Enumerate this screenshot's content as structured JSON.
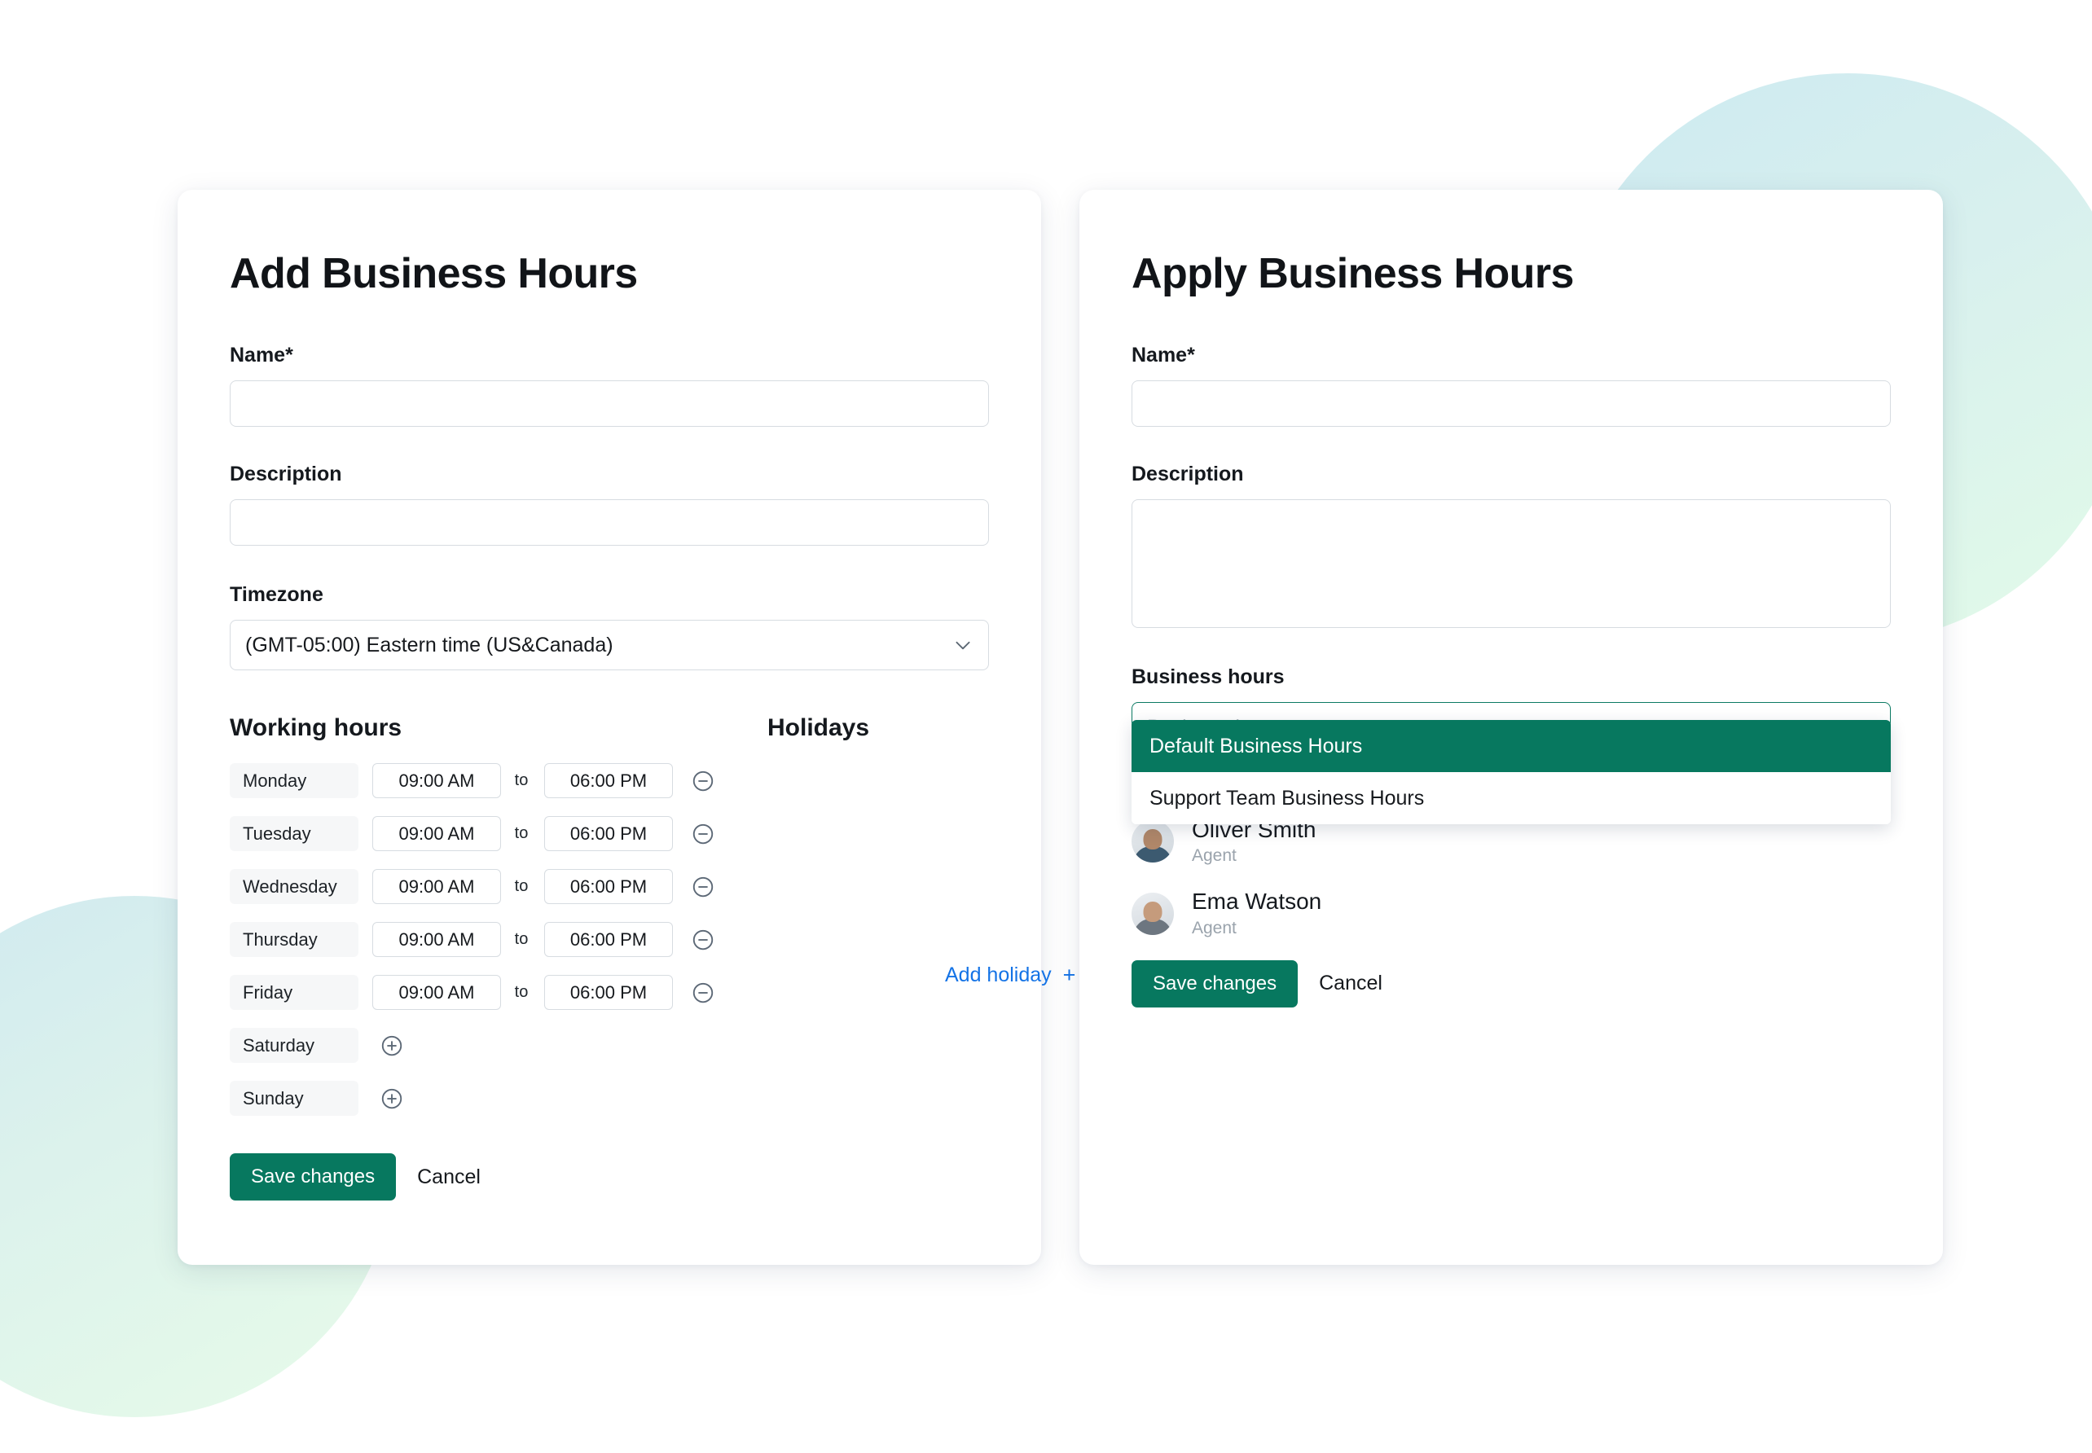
{
  "theme": {
    "accent_teal": "#07785f",
    "link_blue": "#1473e6",
    "border_gray": "#d7dce1",
    "pill_gray": "#f6f7f8",
    "muted_text": "#9aa3ac",
    "blob_gradient_from": "#cdeaf1",
    "blob_gradient_to": "#e2fbe8"
  },
  "add_card": {
    "title": "Add Business Hours",
    "name": {
      "label": "Name*",
      "value": "",
      "placeholder": ""
    },
    "description": {
      "label": "Description",
      "value": "",
      "placeholder": ""
    },
    "timezone": {
      "label": "Timezone",
      "value": "(GMT-05:00) Eastern time (US&Canada)",
      "chevron_icon": "chevron-down-icon"
    },
    "working_hours": {
      "heading": "Working hours",
      "separator": "to",
      "rows": [
        {
          "day": "Monday",
          "start": "09:00 AM",
          "end": "06:00 PM",
          "enabled": true,
          "action_icon": "circle-minus-icon"
        },
        {
          "day": "Tuesday",
          "start": "09:00 AM",
          "end": "06:00 PM",
          "enabled": true,
          "action_icon": "circle-minus-icon"
        },
        {
          "day": "Wednesday",
          "start": "09:00 AM",
          "end": "06:00 PM",
          "enabled": true,
          "action_icon": "circle-minus-icon"
        },
        {
          "day": "Thursday",
          "start": "09:00 AM",
          "end": "06:00 PM",
          "enabled": true,
          "action_icon": "circle-minus-icon"
        },
        {
          "day": "Friday",
          "start": "09:00 AM",
          "end": "06:00 PM",
          "enabled": true,
          "action_icon": "circle-minus-icon"
        },
        {
          "day": "Saturday",
          "start": "",
          "end": "",
          "enabled": false,
          "action_icon": "circle-plus-icon"
        },
        {
          "day": "Sunday",
          "start": "",
          "end": "",
          "enabled": false,
          "action_icon": "circle-plus-icon"
        }
      ]
    },
    "holidays": {
      "heading": "Holidays",
      "add_label": "Add holiday",
      "add_plus": "+"
    },
    "actions": {
      "save_label": "Save changes",
      "cancel_label": "Cancel"
    }
  },
  "apply_card": {
    "title": "Apply Business Hours",
    "name": {
      "label": "Name*",
      "value": "",
      "placeholder": ""
    },
    "description": {
      "label": "Description",
      "value": "",
      "placeholder": ""
    },
    "business_hours": {
      "label": "Business hours",
      "value": "",
      "placeholder": "Business hours",
      "chevron_icon": "chevron-down-icon",
      "open": true,
      "options": [
        {
          "label": "Default Business Hours",
          "selected": true
        },
        {
          "label": "Support Team Business Hours",
          "selected": false
        }
      ]
    },
    "agents": [
      {
        "name": "Oliver Smith",
        "role": "Agent",
        "avatar": "agent-photo-avatar"
      },
      {
        "name": "Ema Watson",
        "role": "Agent",
        "avatar": "agent-photo-avatar"
      }
    ],
    "actions": {
      "save_label": "Save changes",
      "cancel_label": "Cancel"
    }
  }
}
